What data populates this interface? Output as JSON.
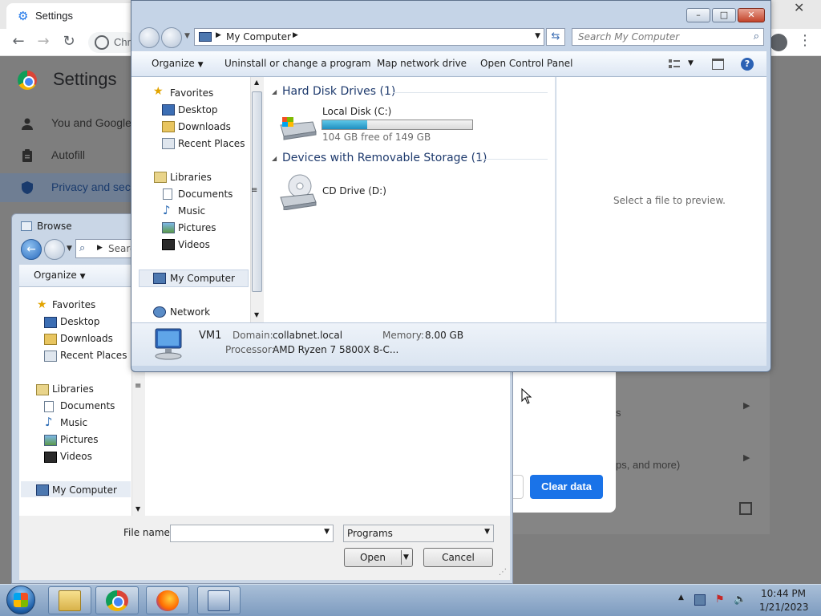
{
  "chrome": {
    "tab_title": "Settings",
    "omnibox_text": "Chr",
    "page_title": "Settings",
    "sidebar": [
      {
        "label": "You and Google",
        "icon": "person-icon"
      },
      {
        "label": "Autofill",
        "icon": "clipboard-icon"
      },
      {
        "label": "Privacy and sec",
        "icon": "shield-icon"
      }
    ],
    "clear_data_label": "Clear data",
    "row_text_1": "s",
    "row_text_2": "ps, and more)"
  },
  "browse": {
    "title": "Browse",
    "search_placeholder": "Searc",
    "organize_label": "Organize",
    "nav": {
      "favorites": "Favorites",
      "favorites_items": [
        "Desktop",
        "Downloads",
        "Recent Places"
      ],
      "libraries": "Libraries",
      "libraries_items": [
        "Documents",
        "Music",
        "Pictures",
        "Videos"
      ],
      "my_computer": "My Computer"
    },
    "file_name_label": "File name:",
    "file_name_value": "",
    "file_type": "Programs",
    "open_label": "Open",
    "cancel_label": "Cancel"
  },
  "explorer": {
    "address": "My Computer",
    "search_placeholder": "Search My Computer",
    "toolbar": {
      "organize": "Organize",
      "uninstall": "Uninstall or change a program",
      "map_drive": "Map network drive",
      "control_panel": "Open Control Panel"
    },
    "nav": {
      "favorites": "Favorites",
      "favorites_items": [
        "Desktop",
        "Downloads",
        "Recent Places"
      ],
      "libraries": "Libraries",
      "libraries_items": [
        "Documents",
        "Music",
        "Pictures",
        "Videos"
      ],
      "my_computer": "My Computer",
      "network": "Network"
    },
    "groups": [
      {
        "header": "Hard Disk Drives (1)",
        "items": [
          {
            "name": "Local Disk (C:)",
            "free_text": "104 GB free of 149 GB",
            "used_fraction": 0.302
          }
        ]
      },
      {
        "header": "Devices with Removable Storage (1)",
        "items": [
          {
            "name": "CD Drive (D:)"
          }
        ]
      }
    ],
    "preview_text": "Select a file to preview.",
    "details": {
      "computer_name": "VM1",
      "domain_label": "Domain:",
      "domain_value": "collabnet.local",
      "memory_label": "Memory:",
      "memory_value": "8.00 GB",
      "processor_label": "Processor:",
      "processor_value": "AMD Ryzen 7 5800X 8-C..."
    }
  },
  "taskbar": {
    "time": "10:44 PM",
    "date": "1/21/2023",
    "apps": [
      "folder-icon",
      "chrome-icon",
      "firefox-icon",
      "run-dialog-icon"
    ]
  },
  "colors": {
    "accent": "#1a73e8",
    "explorer_frame": "#c5d4e7",
    "group_header": "#1e3a6d",
    "capacity_fill": "#1f8fc0"
  }
}
